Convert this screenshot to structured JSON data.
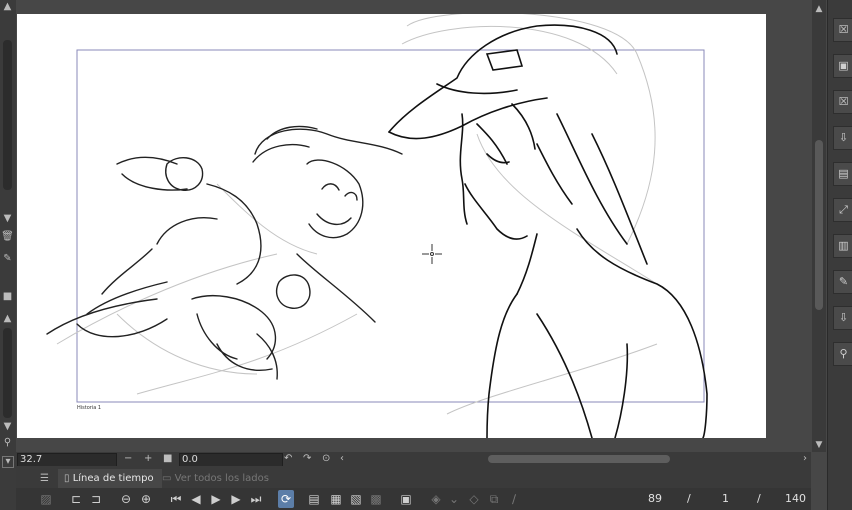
{
  "status": {
    "zoom_value": "32.7",
    "rotation_value": "0.0",
    "zoom_out_glyph": "−",
    "zoom_in_glyph": "+",
    "rotate_left_glyph": "↶",
    "rotate_right_glyph": "↷",
    "scroll_left_glyph": "‹",
    "scroll_right_glyph": "›"
  },
  "canvas": {
    "frame_label": "Historia 1"
  },
  "timeline": {
    "tab_active_label": "Línea de tiempo",
    "tab_inactive_label": "Ver todos los lados",
    "current_frame": "89",
    "separator": "/",
    "frame_b": "1",
    "total_frames": "140"
  },
  "icons": {
    "left_strip": [
      "chevron-up-icon",
      "chevron-down-icon",
      "trash-icon",
      "edit-icon",
      "lock-icon",
      "chevron-up-icon",
      "chevron-down-icon",
      "search-icon",
      "chevron-down-icon"
    ],
    "right_panel": [
      "close-icon",
      "close-icon",
      "save-icon",
      "close-icon",
      "import-icon",
      "layer-icon",
      "expand-icon",
      "layer-icon",
      "edit-icon",
      "import-icon",
      "pin-icon"
    ]
  },
  "colors": {
    "accent": "#5c7ea8",
    "frame_border": "#8a8ab8"
  }
}
